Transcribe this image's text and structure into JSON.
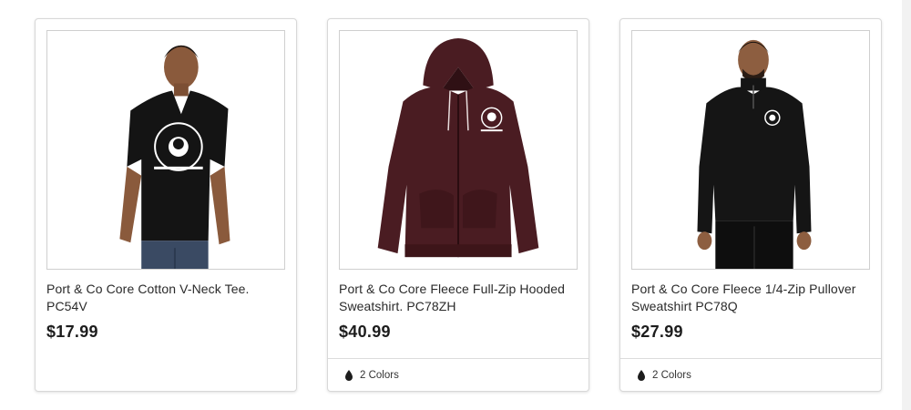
{
  "products": [
    {
      "title": "Port & Co Core Cotton V-Neck Tee. PC54V",
      "price": "$17.99",
      "colors": null,
      "garment_color": "#141414",
      "image_alt": "Model wearing black v-neck tee with Little Lobos Academy logo"
    },
    {
      "title": "Port & Co Core Fleece Full-Zip Hooded Sweatshirt. PC78ZH",
      "price": "$40.99",
      "colors": "2 Colors",
      "garment_color": "#4a1c22",
      "image_alt": "Maroon full-zip hooded sweatshirt with logo"
    },
    {
      "title": "Port & Co Core Fleece 1/4-Zip Pullover Sweatshirt PC78Q",
      "price": "$27.99",
      "colors": "2 Colors",
      "garment_color": "#151515",
      "image_alt": "Model wearing black 1/4-zip pullover sweatshirt"
    }
  ]
}
